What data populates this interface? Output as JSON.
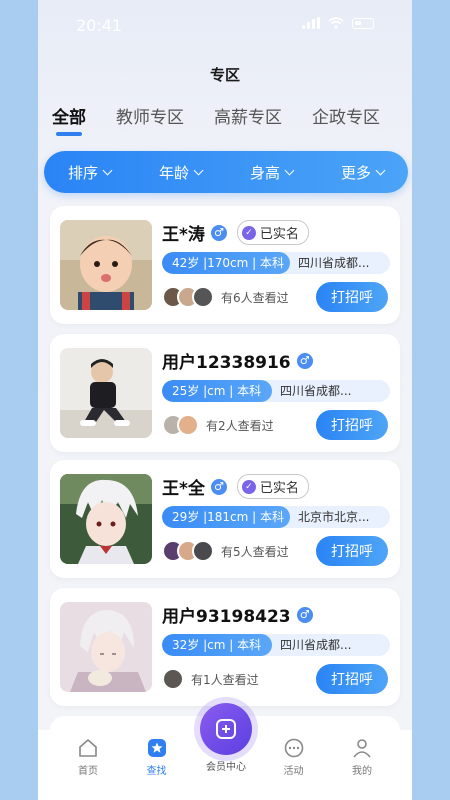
{
  "status": {
    "time": "20:41"
  },
  "page": {
    "title": "专区"
  },
  "tabs": [
    {
      "label": "全部",
      "active": true
    },
    {
      "label": "教师专区",
      "active": false
    },
    {
      "label": "高薪专区",
      "active": false
    },
    {
      "label": "企政专区",
      "active": false
    }
  ],
  "filters": [
    "排序",
    "年龄",
    "身高",
    "更多"
  ],
  "profiles": [
    {
      "name": "王*涛",
      "verified_label": "已实名",
      "info_left": "42岁 |170cm | 本科",
      "location": "四川省成都...",
      "viewers": "有6人查看过",
      "button": "打招呼"
    },
    {
      "name": "用户12338916",
      "info_left": "25岁 |cm | 本科",
      "location": "四川省成都...",
      "viewers": "有2人查看过",
      "button": "打招呼"
    },
    {
      "name": "王*全",
      "verified_label": "已实名",
      "info_left": "29岁 |181cm | 本科",
      "location": "北京市北京...",
      "viewers": "有5人查看过",
      "button": "打招呼"
    },
    {
      "name": "用户93198423",
      "info_left": "32岁 |cm | 本科",
      "location": "四川省成都...",
      "viewers": "有1人查看过",
      "button": "打招呼"
    }
  ],
  "tabbar": {
    "home": "首页",
    "find": "查找",
    "vip": "会员中心",
    "activity": "活动",
    "mine": "我的"
  },
  "colors": {
    "accent": "#2f7ff0",
    "fab": "#6b45e6"
  }
}
